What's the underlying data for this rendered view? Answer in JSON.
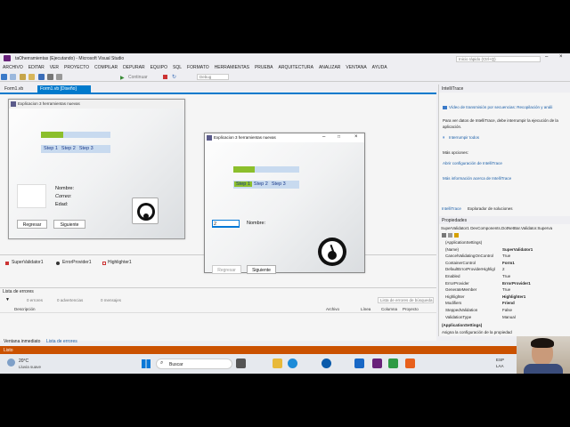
{
  "vs": {
    "title": "taOherramientas (Ejecutando) - Microsoft Visual Studio",
    "quick_launch_placeholder": "Inicio rápido (Ctrl+Q)",
    "menu": [
      "ARCHIVO",
      "EDITAR",
      "VER",
      "PROYECTO",
      "COMPILAR",
      "DEPURAR",
      "EQUIPO",
      "SQL",
      "FORMATO",
      "HERRAMIENTAS",
      "PRUEBA",
      "ARQUITECTURA",
      "ANALIZAR",
      "VENTANA",
      "AYUDA"
    ],
    "toolbar": {
      "continue_label": "Continuar",
      "config_value": "Debug"
    },
    "doc_tabs": [
      {
        "label": "Form1.vb"
      },
      {
        "label": "Form1.vb [Diseño]"
      }
    ]
  },
  "designer_form": {
    "title": "Explicacion 3 herramientas nuevas",
    "progress_fraction": 0.32,
    "steps": [
      "Step 1",
      "Step 2",
      "Step 3"
    ],
    "labels": {
      "nombre": "Nombre:",
      "correo": "Correo:",
      "edad": "Edad:"
    },
    "buttons": {
      "back": "Regresar",
      "next": "Siguiente"
    }
  },
  "running_form": {
    "title": "Explicacion 3 herramientas nuevas",
    "progress_fraction": 0.33,
    "steps": [
      "Step 1",
      "Step 2",
      "Step 3"
    ],
    "active_step": 0,
    "input_value": "2",
    "nombre_label": "Nombre:",
    "buttons": {
      "back": "Regresar",
      "next": "Siguiente"
    }
  },
  "component_tray": [
    "SuperValidator1",
    "ErrorProvider1",
    "Highlighter1"
  ],
  "error_list": {
    "title": "Lista de errores",
    "errors": "0 errores",
    "warnings": "0 advertencias",
    "messages": "0 mensajes",
    "search_placeholder": "Lista de errores de búsqueda",
    "columns": [
      "Descripción",
      "Archivo",
      "Línea",
      "Columna",
      "Proyecto"
    ]
  },
  "bottom_tabs": [
    "Ventana inmediato",
    "Lista de errores"
  ],
  "intellitrace": {
    "title": "IntelliTrace",
    "video_text": "Vídeo de transmisión por secuencias: Recopilación y análi",
    "body_text": "Para ver datos de IntelliTrace, debe interrumpir la ejecución de la aplicación.",
    "break_link": "Interrumpir todos",
    "options_label": "Más opciones:",
    "config_link": "Abrir configuración de IntelliTrace",
    "more_info_link": "Más información acerca de IntelliTrace",
    "tabs": [
      "IntelliTrace",
      "Explorador de soluciones"
    ]
  },
  "properties": {
    "title": "Propiedades",
    "object": "SuperValidator1  DevComponents.DotNetBar.Validator.Superva",
    "rows": [
      {
        "name": "(ApplicationSettings)",
        "value": ""
      },
      {
        "name": "(Name)",
        "value": "SuperValidator1"
      },
      {
        "name": "CancelValidatingOnControl",
        "value": "True"
      },
      {
        "name": "ContainerControl",
        "value": "Form1"
      },
      {
        "name": "DefaultErrorProviderHighligl",
        "value": "2"
      },
      {
        "name": "Enabled",
        "value": "True"
      },
      {
        "name": "ErrorProvider",
        "value": "ErrorProvider1"
      },
      {
        "name": "GenerateMember",
        "value": "True"
      },
      {
        "name": "Highlighter",
        "value": "Highlighter1"
      },
      {
        "name": "Modifiers",
        "value": "Friend"
      },
      {
        "name": "SteppedValidation",
        "value": "False"
      },
      {
        "name": "ValidationType",
        "value": "Manual"
      }
    ],
    "desc_title": "(ApplicationSettings)",
    "desc_text": "Asigna la configuración de la propiedad"
  },
  "status": "Listo",
  "taskbar": {
    "weather_temp": "20°C",
    "weather_desc": "Lluvia suave",
    "search_label": "Buscar",
    "lang": "ESP",
    "lang2": "LAA"
  }
}
